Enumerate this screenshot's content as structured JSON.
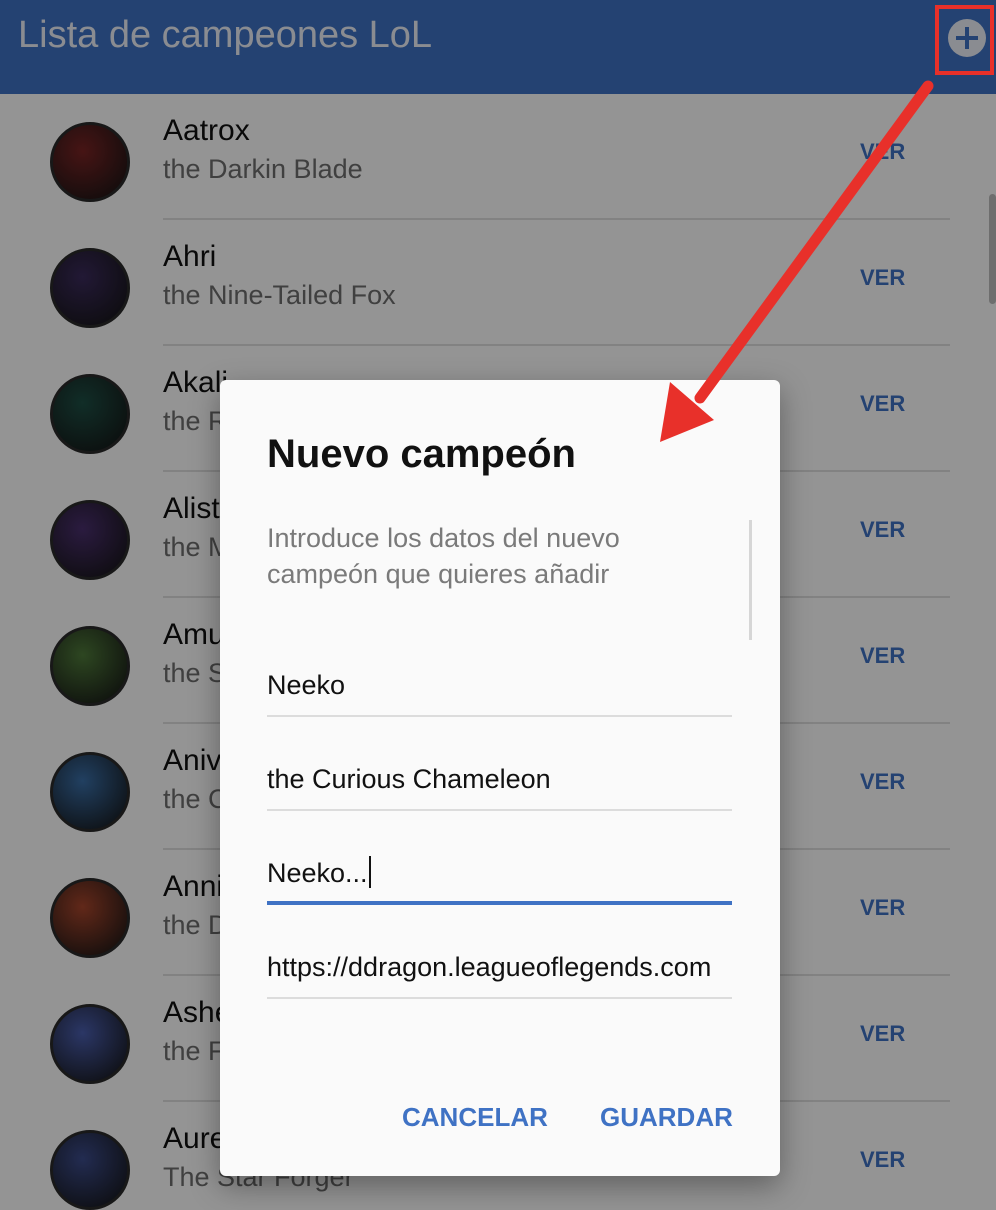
{
  "app_bar": {
    "title": "Lista de campeones LoL",
    "add_icon": "plus-circle-icon"
  },
  "champions": [
    {
      "name": "Aatrox",
      "title": "the Darkin Blade",
      "action": "VER"
    },
    {
      "name": "Ahri",
      "title": "the Nine-Tailed Fox",
      "action": "VER"
    },
    {
      "name": "Akali",
      "title": "the Rogue Assassin",
      "action": "VER"
    },
    {
      "name": "Alistar",
      "title": "the Minotaur",
      "action": "VER"
    },
    {
      "name": "Amumu",
      "title": "the Sad Mummy",
      "action": "VER"
    },
    {
      "name": "Anivia",
      "title": "the Cryophoenix",
      "action": "VER"
    },
    {
      "name": "Annie",
      "title": "the Dark Child",
      "action": "VER"
    },
    {
      "name": "Ashe",
      "title": "the Frost Archer",
      "action": "VER"
    },
    {
      "name": "Aurelion Sol",
      "title": "The Star Forger",
      "action": "VER"
    }
  ],
  "dialog": {
    "title": "Nuevo campeón",
    "description": "Introduce los datos del nuevo campeón que quieres añadir",
    "fields": [
      "Neeko",
      "the Curious Chameleon",
      "Neeko...",
      "https://ddragon.leagueoflegends.com"
    ],
    "cancel_label": "CANCELAR",
    "save_label": "GUARDAR"
  },
  "colors": {
    "primary": "#3f72c4",
    "annotation": "#e8302a",
    "avatars": [
      "#7a2424",
      "#3b2b5c",
      "#1e4f45",
      "#4a2f6e",
      "#4f7a3a",
      "#3a6fa8",
      "#a8462c",
      "#4b5fb0",
      "#3c4c8c"
    ]
  }
}
